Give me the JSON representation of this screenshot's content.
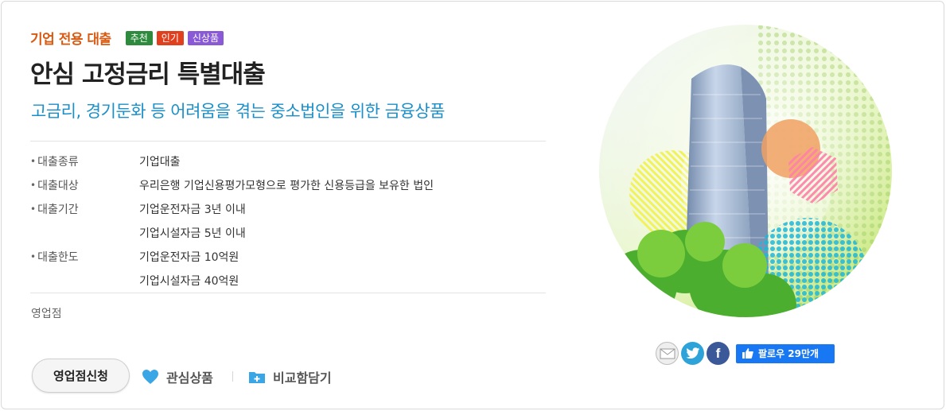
{
  "product": {
    "category": "기업 전용 대출",
    "badges": [
      {
        "label": "추천",
        "color": "#2e8b3e"
      },
      {
        "label": "인기",
        "color": "#e0401d"
      },
      {
        "label": "신상품",
        "color": "#8a5ad6"
      }
    ],
    "title": "안심 고정금리 특별대출",
    "subtitle": "고금리, 경기둔화 등 어려움을 겪는 중소법인을 위한 금융상품"
  },
  "info": [
    {
      "label": "대출종류",
      "value": "기업대출"
    },
    {
      "label": "대출대상",
      "value": "우리은행 기업신용평가모형으로 평가한 신용등급을 보유한 법인"
    },
    {
      "label": "대출기간",
      "value": "기업운전자금 3년 이내"
    },
    {
      "label": "",
      "value": "기업시설자금 5년 이내"
    },
    {
      "label": "대출한도",
      "value": "기업운전자금 10억원"
    },
    {
      "label": "",
      "value": "기업시설자금 40억원"
    }
  ],
  "branch_label": "영업점",
  "actions": {
    "apply": "영업점신청",
    "favorite": "관심상품",
    "compare": "비교함담기"
  },
  "share": {
    "icons": [
      "mail-icon",
      "twitter-icon",
      "facebook-icon"
    ],
    "facebook_letter": "f",
    "follow_label": "팔로우 29만개"
  },
  "colors": {
    "category": "#d85a12",
    "subtitle": "#1a8fc9",
    "facebook_blue": "#1877f2"
  }
}
